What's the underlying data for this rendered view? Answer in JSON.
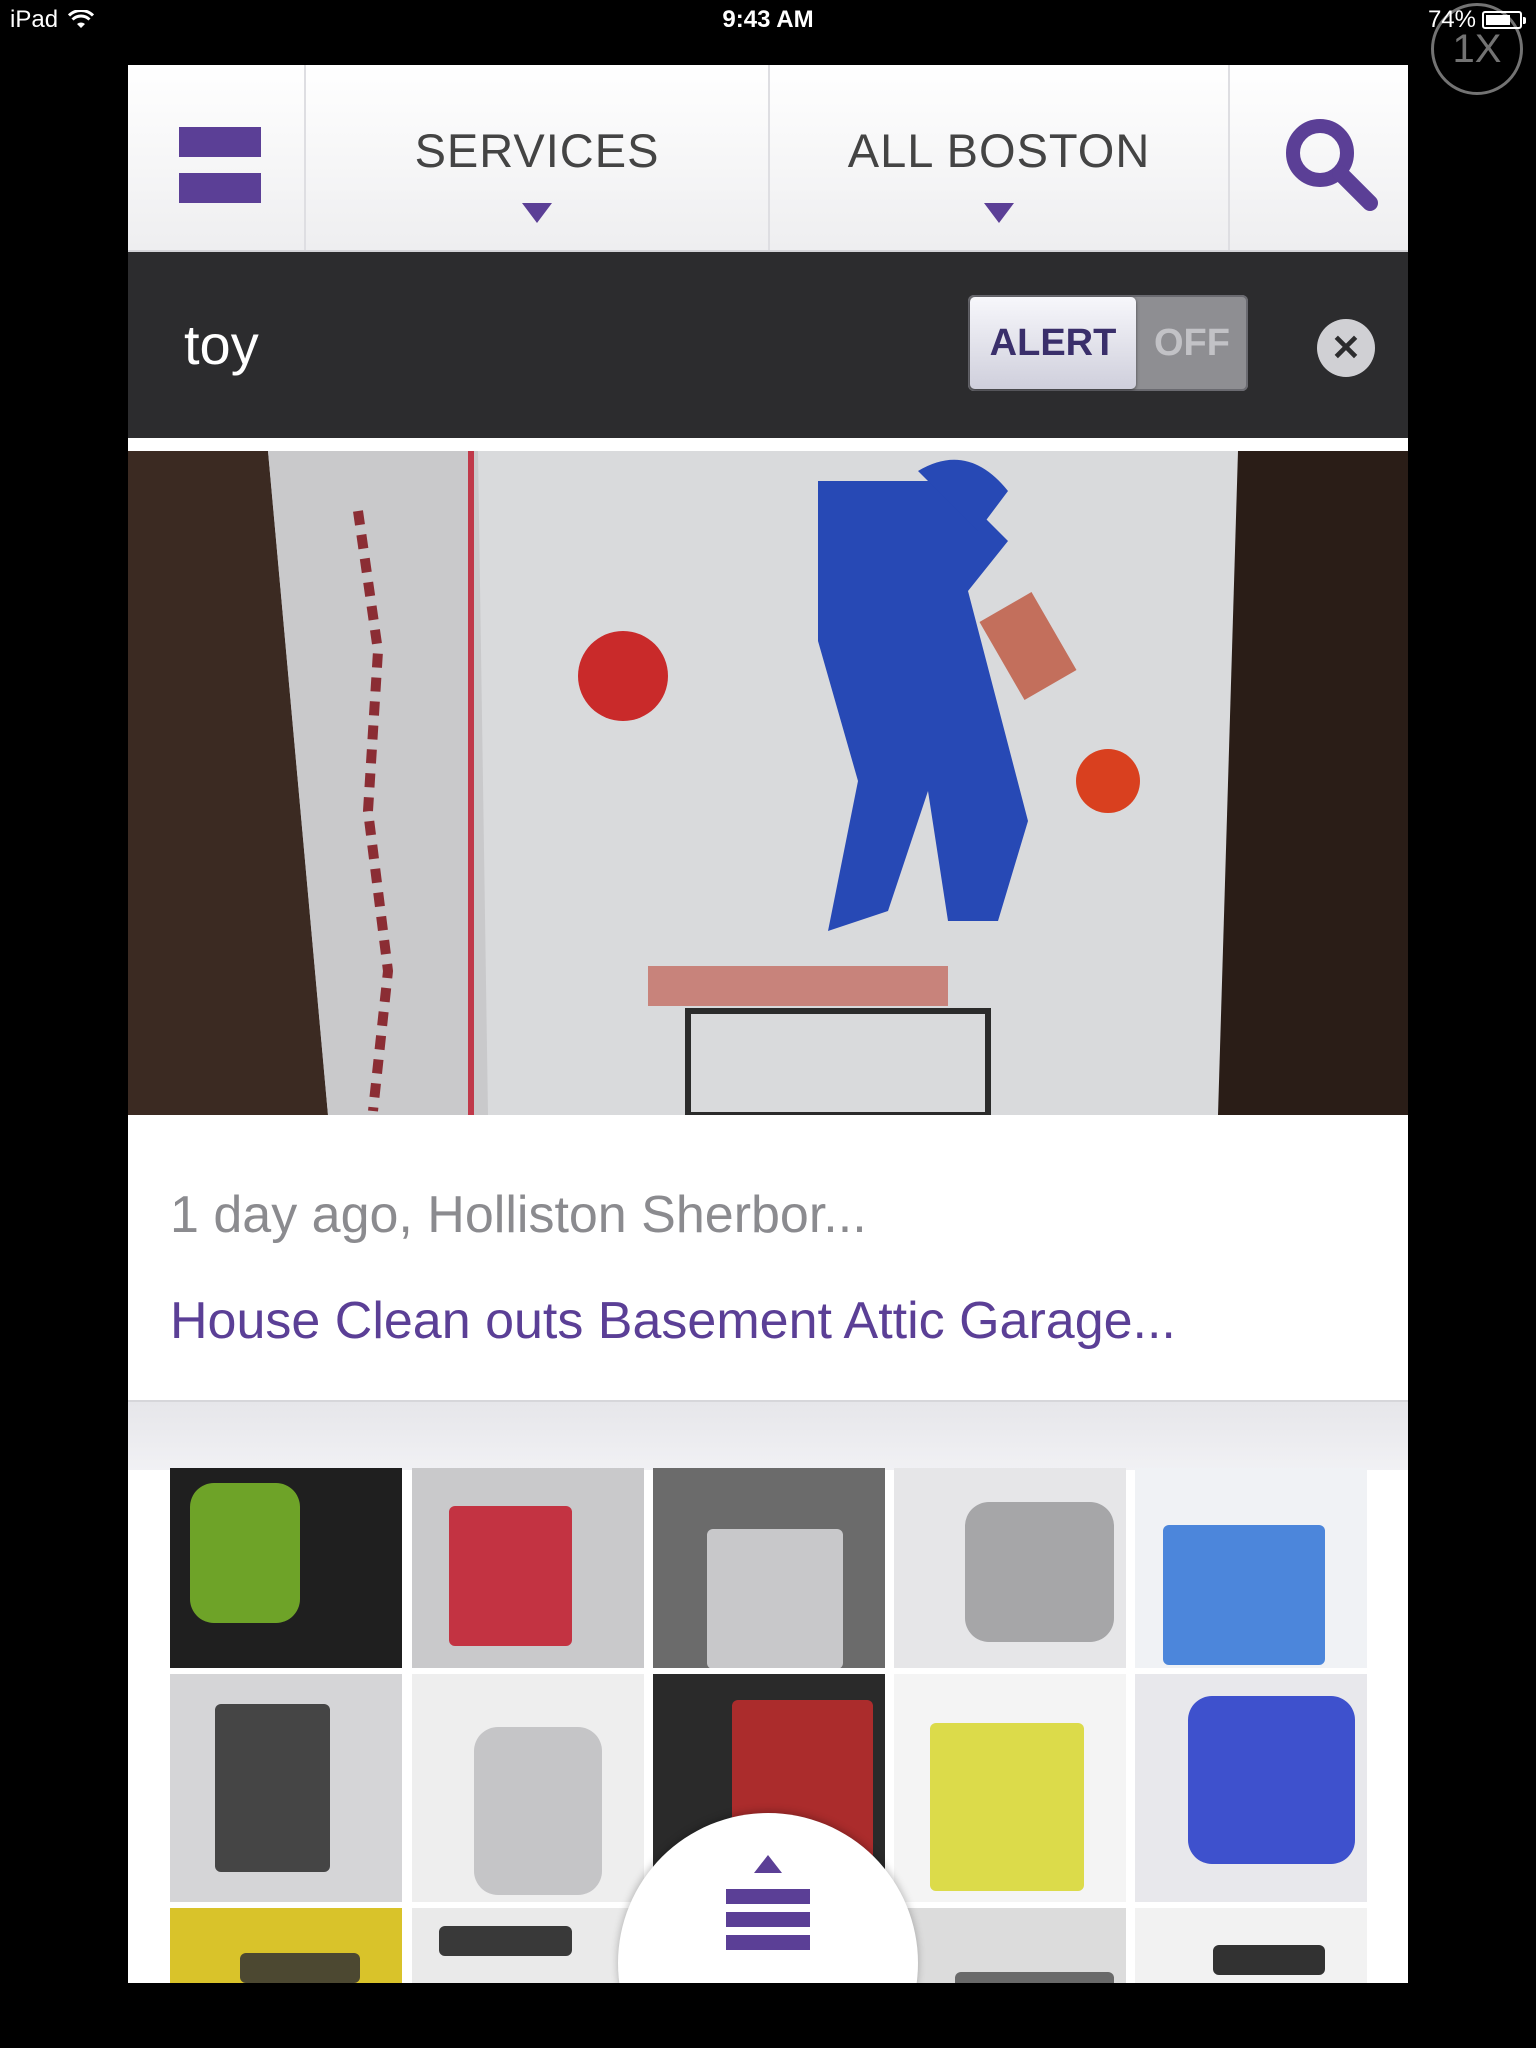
{
  "status_bar": {
    "device": "iPad",
    "time": "9:43 AM",
    "battery": "74%",
    "battery_level": 0.74,
    "zoom": "1X"
  },
  "nav": {
    "category": "SERVICES",
    "location": "ALL BOSTON"
  },
  "search": {
    "query": "toy",
    "alert_on_label": "ALERT",
    "alert_off_label": "OFF"
  },
  "listing": {
    "meta": "1 day ago, Holliston Sherbor...",
    "title": "House Clean outs Basement Attic Garage..."
  },
  "colors": {
    "accent": "#5b3f96",
    "search_bar": "#2c2c2e"
  }
}
